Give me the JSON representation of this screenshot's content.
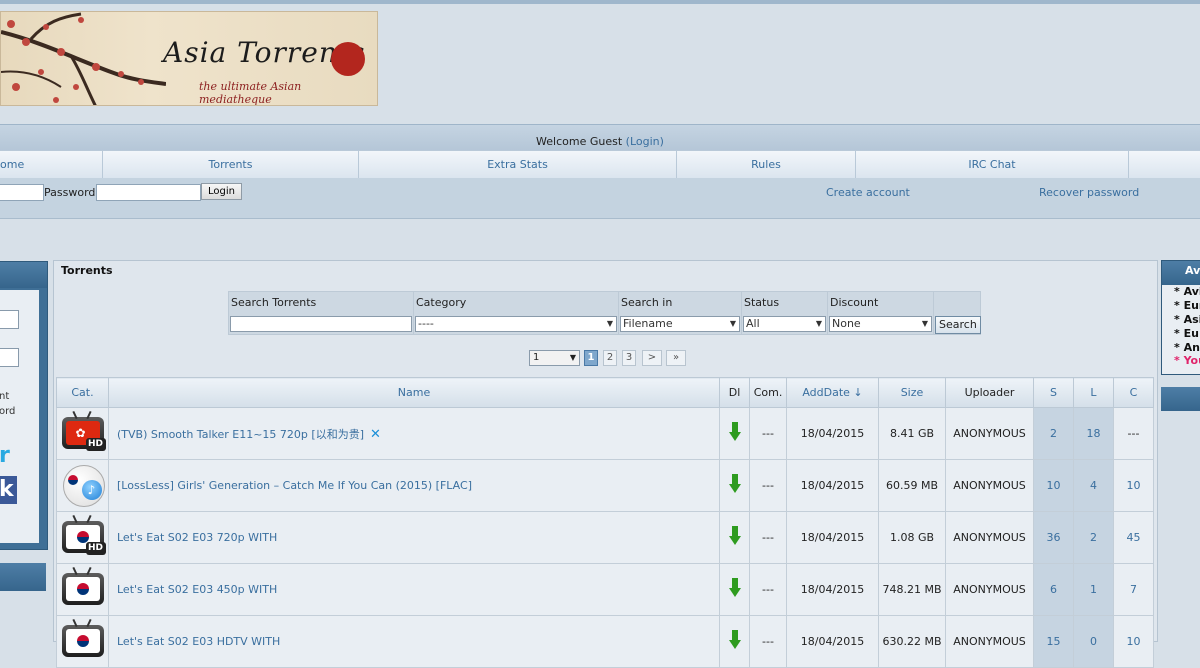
{
  "banner": {
    "logo_text": "Asia Torrents",
    "tagline": "the ultimate Asian mediatheque"
  },
  "welcome": {
    "prefix": "Welcome Guest ",
    "login_link": "(Login)"
  },
  "nav": [
    "ome",
    "Torrents",
    "Extra Stats",
    "Rules",
    "IRC Chat"
  ],
  "login": {
    "password_label": "Password:",
    "login_button": "Login",
    "create_account": "Create account",
    "recover_password": "Recover password"
  },
  "left_panel": {
    "text1": "nt",
    "text2": "ord",
    "text3": "r",
    "text4": "k"
  },
  "main": {
    "title": "Torrents",
    "search": {
      "torrents_label": "Search Torrents",
      "category_label": "Category",
      "category_value": "----",
      "search_in_label": "Search in",
      "search_in_value": "Filename",
      "status_label": "Status",
      "status_value": "All",
      "discount_label": "Discount",
      "discount_value": "None",
      "button": "Search"
    },
    "pager": {
      "select_value": "1",
      "pages": [
        "1",
        "2",
        "3",
        ">",
        "»"
      ]
    },
    "columns": [
      "Cat.",
      "Name",
      "Dl",
      "Com.",
      "AddDate ↓",
      "Size",
      "Uploader",
      "S",
      "L",
      "C"
    ],
    "rows": [
      {
        "cat": "hk-hd",
        "name": "(TVB) Smooth Talker E11~15 720p [以和为贵]",
        "com": "---",
        "date": "18/04/2015",
        "size": "8.41 GB",
        "uploader": "ANONYMOUS",
        "s": "2",
        "l": "18",
        "c": "---"
      },
      {
        "cat": "kr-music",
        "name": "[LossLess] Girls' Generation – Catch Me If You Can (2015) [FLAC]",
        "com": "---",
        "date": "18/04/2015",
        "size": "60.59 MB",
        "uploader": "ANONYMOUS",
        "s": "10",
        "l": "4",
        "c": "10"
      },
      {
        "cat": "kr-hd",
        "name": "Let's Eat S02 E03 720p WITH",
        "com": "---",
        "date": "18/04/2015",
        "size": "1.08 GB",
        "uploader": "ANONYMOUS",
        "s": "36",
        "l": "2",
        "c": "45"
      },
      {
        "cat": "kr-sd",
        "name": "Let's Eat S02 E03 450p WITH",
        "com": "---",
        "date": "18/04/2015",
        "size": "748.21 MB",
        "uploader": "ANONYMOUS",
        "s": "6",
        "l": "1",
        "c": "7"
      },
      {
        "cat": "kr-sd",
        "name": "Let's Eat S02 E03 HDTV WITH",
        "com": "---",
        "date": "18/04/2015",
        "size": "630.22 MB",
        "uploader": "ANONYMOUS",
        "s": "15",
        "l": "0",
        "c": "10"
      }
    ]
  },
  "right_panel": {
    "header": "Avi",
    "items": [
      "* Avi",
      "* Eur",
      "* Asi",
      "* Eu",
      "* Ani",
      "* You"
    ]
  },
  "colors": {
    "link": "#3a6f9f",
    "panel_blue": "#3f6f96",
    "download_green": "#2e9b1f"
  }
}
